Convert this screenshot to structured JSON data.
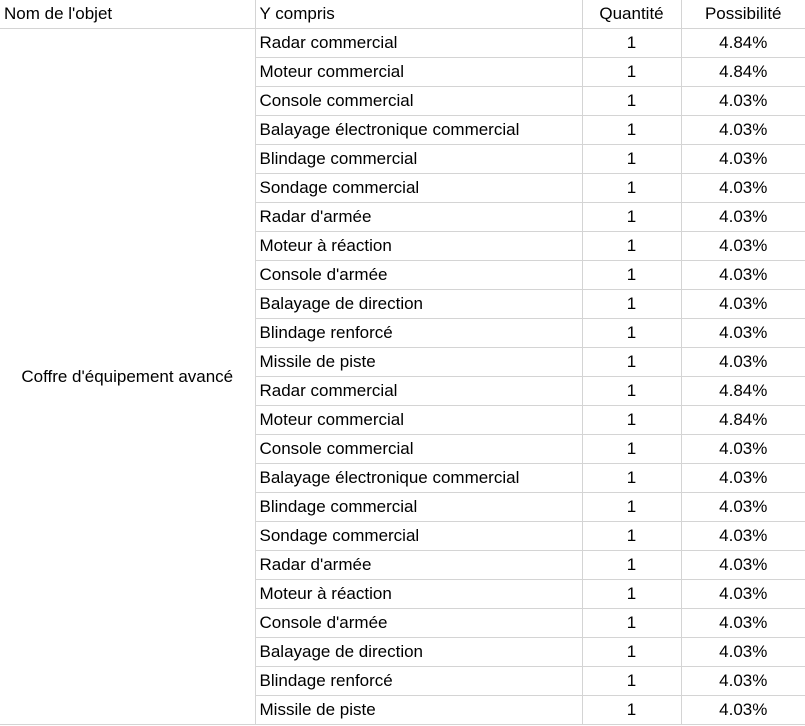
{
  "headers": [
    "Nom de l'objet",
    "Y compris",
    "Quantité",
    "Possibilité"
  ],
  "item_name": "Coffre d'équipement avancé",
  "rows": [
    {
      "included": "Radar commercial",
      "quantity": "1",
      "chance": "4.84%"
    },
    {
      "included": "Moteur commercial",
      "quantity": "1",
      "chance": "4.84%"
    },
    {
      "included": "Console commercial",
      "quantity": "1",
      "chance": "4.03%"
    },
    {
      "included": "Balayage électronique commercial",
      "quantity": "1",
      "chance": "4.03%"
    },
    {
      "included": "Blindage commercial",
      "quantity": "1",
      "chance": "4.03%"
    },
    {
      "included": "Sondage commercial",
      "quantity": "1",
      "chance": "4.03%"
    },
    {
      "included": "Radar d'armée",
      "quantity": "1",
      "chance": "4.03%"
    },
    {
      "included": "Moteur à réaction",
      "quantity": "1",
      "chance": "4.03%"
    },
    {
      "included": "Console d'armée",
      "quantity": "1",
      "chance": "4.03%"
    },
    {
      "included": "Balayage de direction",
      "quantity": "1",
      "chance": "4.03%"
    },
    {
      "included": "Blindage renforcé",
      "quantity": "1",
      "chance": "4.03%"
    },
    {
      "included": "Missile de piste",
      "quantity": "1",
      "chance": "4.03%"
    },
    {
      "included": "Radar commercial",
      "quantity": "1",
      "chance": "4.84%"
    },
    {
      "included": "Moteur commercial",
      "quantity": "1",
      "chance": "4.84%"
    },
    {
      "included": "Console commercial",
      "quantity": "1",
      "chance": "4.03%"
    },
    {
      "included": "Balayage électronique commercial",
      "quantity": "1",
      "chance": "4.03%"
    },
    {
      "included": "Blindage commercial",
      "quantity": "1",
      "chance": "4.03%"
    },
    {
      "included": "Sondage commercial",
      "quantity": "1",
      "chance": "4.03%"
    },
    {
      "included": "Radar d'armée",
      "quantity": "1",
      "chance": "4.03%"
    },
    {
      "included": "Moteur à réaction",
      "quantity": "1",
      "chance": "4.03%"
    },
    {
      "included": "Console d'armée",
      "quantity": "1",
      "chance": "4.03%"
    },
    {
      "included": "Balayage de direction",
      "quantity": "1",
      "chance": "4.03%"
    },
    {
      "included": "Blindage renforcé",
      "quantity": "1",
      "chance": "4.03%"
    },
    {
      "included": "Missile de piste",
      "quantity": "1",
      "chance": "4.03%"
    }
  ]
}
